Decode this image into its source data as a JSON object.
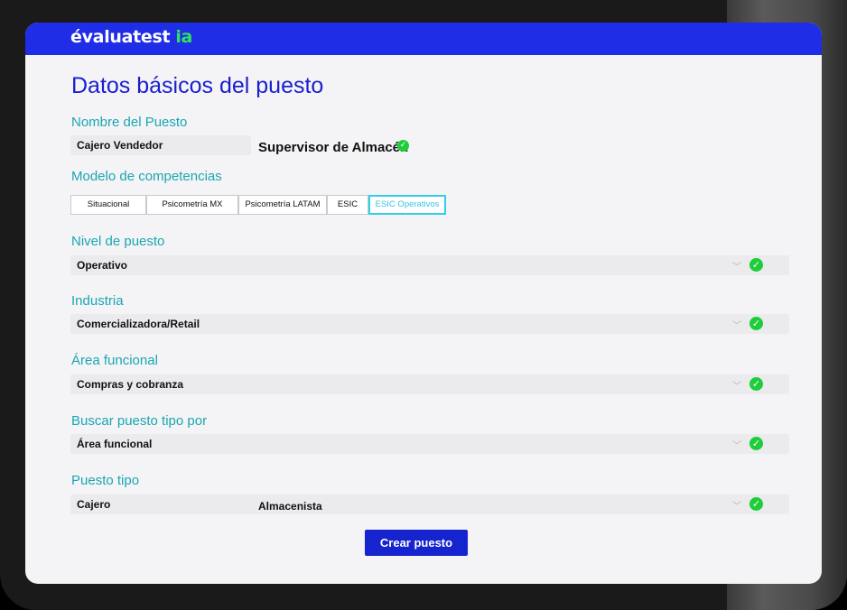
{
  "app": {
    "logo_main": "évaluatest",
    "logo_suffix": "ia"
  },
  "page": {
    "title": "Datos básicos del puesto"
  },
  "fields": {
    "nombre": {
      "label": "Nombre del Puesto",
      "value": "Cajero Vendedor",
      "overlay": "Supervisor de Almacén"
    },
    "modelo": {
      "label": "Modelo de competencias"
    },
    "nivel": {
      "label": "Nivel de puesto",
      "value": "Operativo"
    },
    "industria": {
      "label": "Industria",
      "value": "Comercializadora/Retail"
    },
    "area": {
      "label": "Área funcional",
      "value": "Compras y cobranza"
    },
    "buscar": {
      "label": "Buscar puesto tipo por",
      "value": "Área funcional"
    },
    "puesto_tipo": {
      "label": "Puesto tipo",
      "value": "Cajero",
      "overlay": "Almacenista"
    }
  },
  "tabs": [
    {
      "label": "Situacional",
      "active": false
    },
    {
      "label": "Psicometría MX",
      "active": false
    },
    {
      "label": "Psicometría LATAM",
      "active": false
    },
    {
      "label": "ESIC",
      "active": false
    },
    {
      "label": "ESIC Operativos",
      "active": true
    }
  ],
  "icons": {
    "check": "check-circle-icon",
    "chevron": "chevron-down-icon"
  },
  "actions": {
    "create_label": "Crear puesto"
  },
  "colors": {
    "brand": "#1f2de6",
    "accent": "#1aa6b2",
    "success": "#1dcd3b",
    "logo_accent": "#2fe35a"
  }
}
